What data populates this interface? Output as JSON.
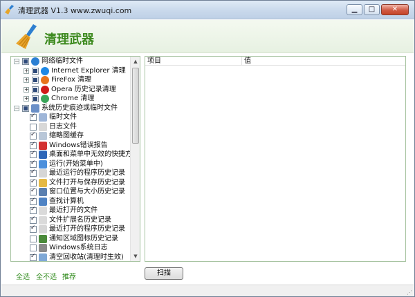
{
  "window": {
    "title": "清理武器 V1.3 www.zwuqi.com",
    "minimize_glyph": "▁",
    "maximize_glyph": "□",
    "close_glyph": "✕"
  },
  "banner": {
    "heading": "清理武器",
    "logo_icon": "broom-icon"
  },
  "tree": {
    "items": [
      {
        "label": "网络临时文件",
        "level": 0,
        "expander": "⊟",
        "check": "partial",
        "icon": "globe-icon",
        "icon_color": "#2b7fd3"
      },
      {
        "label": "Internet Explorer 清理",
        "level": 1,
        "expander": "⊞",
        "check": "partial",
        "icon": "ie-icon",
        "icon_color": "#1e88e5"
      },
      {
        "label": "FireFox 清理",
        "level": 1,
        "expander": "⊞",
        "check": "partial",
        "icon": "firefox-icon",
        "icon_color": "#e8741c"
      },
      {
        "label": "Opera 历史记录清理",
        "level": 1,
        "expander": "⊞",
        "check": "partial",
        "icon": "opera-icon",
        "icon_color": "#d01a1a"
      },
      {
        "label": "Chrome 清理",
        "level": 1,
        "expander": "⊞",
        "check": "partial",
        "icon": "chrome-icon",
        "icon_color": "#3aa55a"
      },
      {
        "label": "系统历史痕迹或临时文件",
        "level": 0,
        "expander": "⊟",
        "check": "partial",
        "icon": "system-icon",
        "icon_color": "#6a8fc7"
      },
      {
        "label": "临时文件",
        "level": 1,
        "expander": "",
        "check": "checked",
        "icon": "file-icon",
        "icon_color": "#9fb6d8"
      },
      {
        "label": "日志文件",
        "level": 1,
        "expander": "",
        "check": "unchecked",
        "icon": "log-icon",
        "icon_color": "#d8d8d8"
      },
      {
        "label": "缩略图缓存",
        "level": 1,
        "expander": "",
        "check": "checked",
        "icon": "thumbnail-icon",
        "icon_color": "#b9c7d8"
      },
      {
        "label": "Windows错误报告",
        "level": 1,
        "expander": "",
        "check": "checked",
        "icon": "error-icon",
        "icon_color": "#d33232"
      },
      {
        "label": "桌面和菜单中无效的快捷方式",
        "level": 1,
        "expander": "",
        "check": "checked",
        "icon": "desktop-icon",
        "icon_color": "#2d66b8"
      },
      {
        "label": "运行(开始菜单中)",
        "level": 1,
        "expander": "",
        "check": "checked",
        "icon": "run-icon",
        "icon_color": "#4b8fdc"
      },
      {
        "label": "最近运行的程序历史记录",
        "level": 1,
        "expander": "",
        "check": "checked",
        "icon": "program-icon",
        "icon_color": "#d6d6d6"
      },
      {
        "label": "文件打开与保存历史记录",
        "level": 1,
        "expander": "",
        "check": "checked",
        "icon": "folder-icon",
        "icon_color": "#e5b945"
      },
      {
        "label": "窗口位置与大小历史记录",
        "level": 1,
        "expander": "",
        "check": "checked",
        "icon": "window-icon",
        "icon_color": "#5a7fb0"
      },
      {
        "label": "查找计算机",
        "level": 1,
        "expander": "",
        "check": "checked",
        "icon": "search-computer-icon",
        "icon_color": "#4f83c4"
      },
      {
        "label": "最近打开的文件",
        "level": 1,
        "expander": "",
        "check": "checked",
        "icon": "recent-file-icon",
        "icon_color": "#dadada"
      },
      {
        "label": "文件扩展名历史记录",
        "level": 1,
        "expander": "",
        "check": "checked",
        "icon": "extension-icon",
        "icon_color": "#dadada"
      },
      {
        "label": "最近打开的程序历史记录",
        "level": 1,
        "expander": "",
        "check": "checked",
        "icon": "program-icon",
        "icon_color": "#d6d6d6"
      },
      {
        "label": "通知区域图标历史记录",
        "level": 1,
        "expander": "",
        "check": "unchecked",
        "icon": "tray-icon",
        "icon_color": "#4a8a3a"
      },
      {
        "label": "Windows系统日志",
        "level": 1,
        "expander": "",
        "check": "unchecked",
        "icon": "syslog-icon",
        "icon_color": "#8a8a8a"
      },
      {
        "label": "清空回收站(清理时生效)",
        "level": 1,
        "expander": "",
        "check": "checked",
        "icon": "recycle-bin-icon",
        "icon_color": "#7fa8d6"
      }
    ],
    "scroll_up": "▲",
    "scroll_down": "▼"
  },
  "results": {
    "columns": [
      "项目",
      "值"
    ]
  },
  "bottom": {
    "select_all": "全选",
    "select_none": "全不选",
    "recommended": "推荐",
    "scan_button": "扫描"
  },
  "statusbar": {
    "grip": "⋰"
  }
}
